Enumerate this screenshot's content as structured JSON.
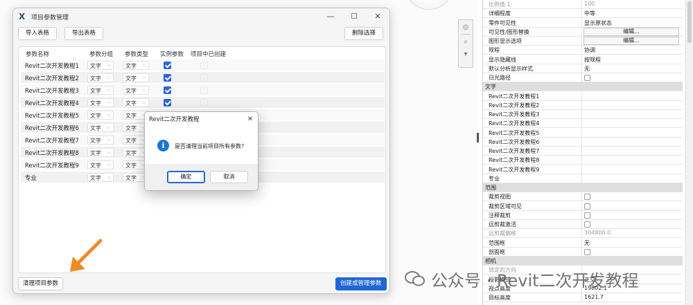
{
  "main_window": {
    "title": "项目参数管理",
    "controls": {
      "minimize": "—",
      "maximize": "☐",
      "close": "✕"
    },
    "toolbar": {
      "import_label": "导入表格",
      "export_label": "导出表格",
      "delete_label": "删除选择"
    },
    "columns": [
      "参数名称",
      "参数分组",
      "参数类型",
      "实例参数",
      "项目中已创建"
    ],
    "rows": [
      {
        "name": "Revit二次开发教程1",
        "group": "文字",
        "type": "文字",
        "instance": true
      },
      {
        "name": "Revit二次开发教程2",
        "group": "文字",
        "type": "文字",
        "instance": true
      },
      {
        "name": "Revit二次开发教程3",
        "group": "文字",
        "type": "文字",
        "instance": true
      },
      {
        "name": "Revit二次开发教程4",
        "group": "文字",
        "type": "文字",
        "instance": true
      },
      {
        "name": "Revit二次开发教程5",
        "group": "文字",
        "type": "文字",
        "instance": true
      },
      {
        "name": "Revit二次开发教程6",
        "group": "文字",
        "type": "文字",
        "instance": false
      },
      {
        "name": "Revit二次开发教程7",
        "group": "文字",
        "type": "文字",
        "instance": false
      },
      {
        "name": "Revit二次开发教程8",
        "group": "文字",
        "type": "文字",
        "instance": false
      },
      {
        "name": "Revit二次开发教程9",
        "group": "文字",
        "type": "文字",
        "instance": false
      },
      {
        "name": "专业",
        "group": "文字",
        "type": "文字",
        "instance": false
      }
    ],
    "footer": {
      "clear_label": "清理项目参数",
      "create_label": "创建或管理参数"
    },
    "accent_color": "#1f66d6"
  },
  "confirm_dialog": {
    "title": "Revit二次开发教程",
    "close": "✕",
    "icon": "info-icon",
    "message": "是否清理当前项目所有参数?",
    "ok_label": "确定",
    "cancel_label": "取消"
  },
  "properties": {
    "rows": [
      {
        "kind": "row",
        "name": "比例值 1:",
        "value": "100",
        "dim": true
      },
      {
        "kind": "row",
        "name": "详细程度",
        "value": "中等"
      },
      {
        "kind": "row",
        "name": "零件可见性",
        "value": "显示原状态"
      },
      {
        "kind": "edit",
        "name": "可见性/图形替换",
        "value": "编辑..."
      },
      {
        "kind": "edit",
        "name": "图形显示选项",
        "value": "编辑..."
      },
      {
        "kind": "row",
        "name": "规程",
        "value": "协调"
      },
      {
        "kind": "row",
        "name": "显示隐藏线",
        "value": "按规程"
      },
      {
        "kind": "row",
        "name": "默认分析显示样式",
        "value": "无"
      },
      {
        "kind": "check",
        "name": "日光路径",
        "value": ""
      },
      {
        "kind": "section",
        "name": "文字",
        "value": ""
      },
      {
        "kind": "row",
        "name": "Revit二次开发教程1",
        "value": ""
      },
      {
        "kind": "row",
        "name": "Revit二次开发教程2",
        "value": ""
      },
      {
        "kind": "row",
        "name": "Revit二次开发教程3",
        "value": ""
      },
      {
        "kind": "row",
        "name": "Revit二次开发教程4",
        "value": ""
      },
      {
        "kind": "row",
        "name": "Revit二次开发教程5",
        "value": ""
      },
      {
        "kind": "row",
        "name": "Revit二次开发教程6",
        "value": ""
      },
      {
        "kind": "row",
        "name": "Revit二次开发教程7",
        "value": ""
      },
      {
        "kind": "row",
        "name": "Revit二次开发教程8",
        "value": ""
      },
      {
        "kind": "row",
        "name": "Revit二次开发教程9",
        "value": ""
      },
      {
        "kind": "row",
        "name": "专业",
        "value": ""
      },
      {
        "kind": "section",
        "name": "范围",
        "value": ""
      },
      {
        "kind": "check",
        "name": "裁剪视图",
        "value": ""
      },
      {
        "kind": "check",
        "name": "裁剪区域可见",
        "value": ""
      },
      {
        "kind": "check",
        "name": "注释裁剪",
        "value": ""
      },
      {
        "kind": "check",
        "name": "远剪裁激活",
        "value": ""
      },
      {
        "kind": "row",
        "name": "远剪裁偏移",
        "value": "304800.0",
        "dim": true
      },
      {
        "kind": "row",
        "name": "范围框",
        "value": "无"
      },
      {
        "kind": "check",
        "name": "剖面框",
        "value": ""
      },
      {
        "kind": "section",
        "name": "相机",
        "value": ""
      },
      {
        "kind": "row",
        "name": "锁定的方向",
        "value": "",
        "dim": true
      },
      {
        "kind": "row",
        "name": "投影模式",
        "value": "正交"
      },
      {
        "kind": "row",
        "name": "视点高度",
        "value": "19802.1"
      },
      {
        "kind": "row",
        "name": "目标高度",
        "value": "1621.7"
      }
    ]
  },
  "watermark": {
    "text": "公众号 · Revit二次开发教程"
  }
}
